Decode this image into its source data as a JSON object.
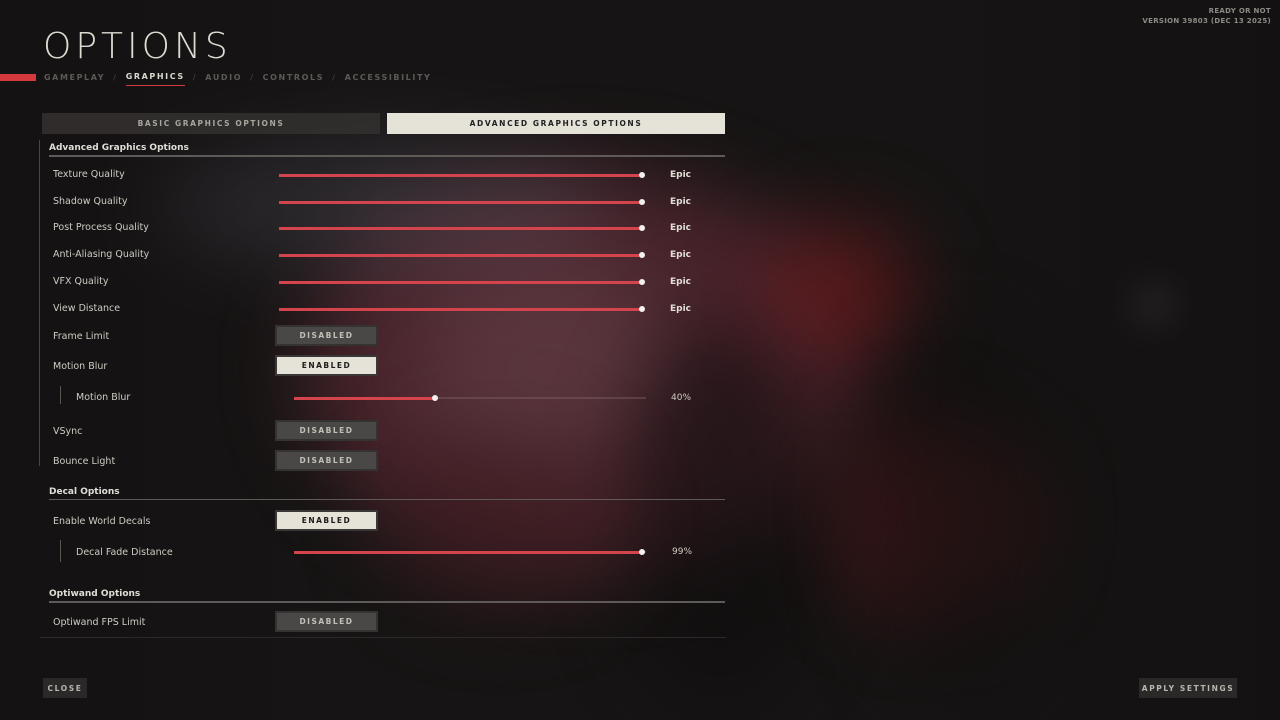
{
  "header": {
    "title": "OPTIONS",
    "tabs": [
      {
        "label": "GAMEPLAY",
        "active": false
      },
      {
        "label": "GRAPHICS",
        "active": true
      },
      {
        "label": "AUDIO",
        "active": false
      },
      {
        "label": "CONTROLS",
        "active": false
      },
      {
        "label": "ACCESSIBILITY",
        "active": false
      }
    ],
    "separator": "/",
    "game_name": "READY OR NOT",
    "version": "VERSION 39803 (DEC 13 2025)"
  },
  "subtabs": {
    "basic": "BASIC GRAPHICS OPTIONS",
    "advanced": "ADVANCED GRAPHICS OPTIONS",
    "active": "advanced"
  },
  "sections": {
    "advanced": {
      "title": "Advanced Graphics Options",
      "quality_rows": [
        {
          "label": "Texture Quality",
          "value": "Epic",
          "level": 1.0
        },
        {
          "label": "Shadow Quality",
          "value": "Epic",
          "level": 1.0
        },
        {
          "label": "Post Process Quality",
          "value": "Epic",
          "level": 1.0
        },
        {
          "label": "Anti-Aliasing Quality",
          "value": "Epic",
          "level": 1.0
        },
        {
          "label": "VFX Quality",
          "value": "Epic",
          "level": 1.0
        },
        {
          "label": "View Distance",
          "value": "Epic",
          "level": 1.0
        }
      ],
      "frame_limit": {
        "label": "Frame Limit",
        "state": "DISABLED"
      },
      "motion_blur": {
        "label": "Motion Blur",
        "state": "ENABLED"
      },
      "motion_blur_amount": {
        "label": "Motion Blur",
        "value_text": "40%",
        "percent": 40
      },
      "vsync": {
        "label": "VSync",
        "state": "DISABLED"
      },
      "bounce_light": {
        "label": "Bounce Light",
        "state": "DISABLED"
      }
    },
    "decal": {
      "title": "Decal Options",
      "world_decals": {
        "label": "Enable World Decals",
        "state": "ENABLED"
      },
      "fade_distance": {
        "label": "Decal Fade Distance",
        "value_text": "99%",
        "percent": 99
      }
    },
    "optiwand": {
      "title": "Optiwand Options",
      "fps_limit": {
        "label": "Optiwand FPS Limit",
        "state": "DISABLED"
      }
    }
  },
  "footer": {
    "close": "CLOSE",
    "apply": "APPLY SETTINGS"
  },
  "colors": {
    "accent": "#d5383d",
    "slider_fill": "#d4444c",
    "active_button": "#e5e2d8",
    "inactive_button": "#4a4846"
  }
}
